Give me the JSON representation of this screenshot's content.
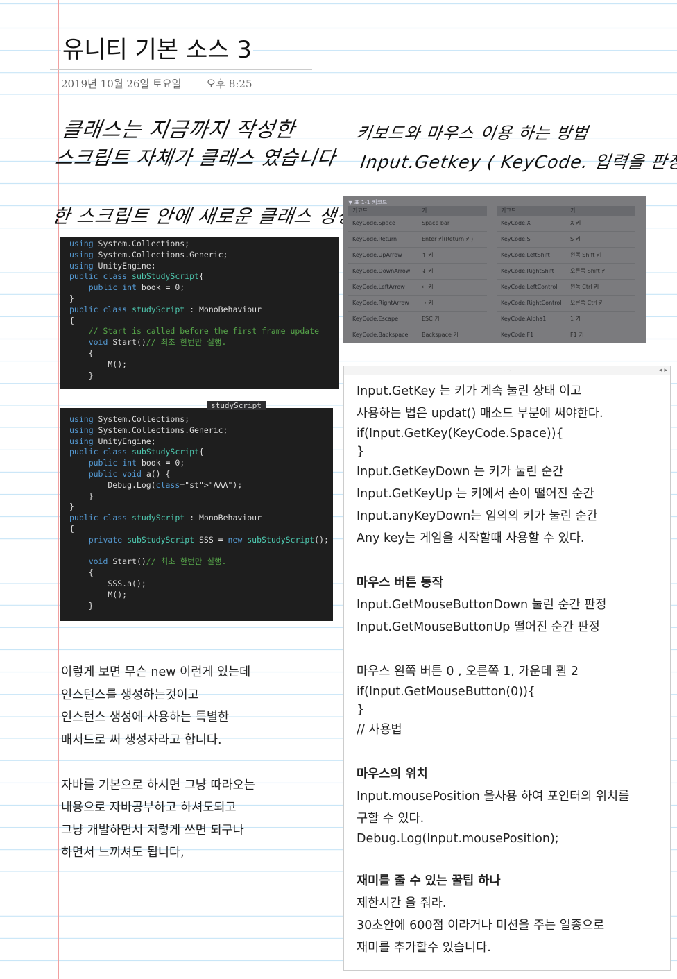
{
  "note": {
    "title": "유니티 기본 소스 3",
    "date": "2019년 10월 26일 토요일",
    "time": "오후 8:25"
  },
  "handwriting": {
    "line1": "클래스는 지금까지 작성한",
    "line2": "스크립트 자체가 클래스 였습니다",
    "line3": "한 스크립트 안에 새로운 클래스 생성 가능",
    "right1": "키보드와 마우스 이용 하는 방법",
    "right2": "Input.Getkey ( KeyCode. 입력을 판정할키)"
  },
  "code1": {
    "lines": [
      "using System.Collections;",
      "using System.Collections.Generic;",
      "using UnityEngine;",
      "public class subStudyScript{",
      "    public int book = 0;",
      "}",
      "public class studyScript : MonoBehaviour",
      "{",
      "    // Start is called before the first frame update",
      "    void Start()// 최초 한번만 실행.",
      "    {",
      "        M();",
      "    }"
    ]
  },
  "code2": {
    "tab": "studyScript",
    "lines": [
      "using System.Collections;",
      "using System.Collections.Generic;",
      "using UnityEngine;",
      "public class subStudyScript{",
      "    public int book = 0;",
      "    public void a() {",
      "        Debug.Log(\"AAA\");",
      "    }",
      "}",
      "public class studyScript : MonoBehaviour",
      "{",
      "    private subStudyScript SSS = new subStudyScript();",
      "",
      "    void Start()// 최초 한번만 실행.",
      "    {",
      "        SSS.a();",
      "        M();",
      "    }"
    ]
  },
  "keytable": {
    "caption": "▼ 표 1-1 키코드",
    "head_key": "키코드",
    "head_val": "키",
    "left": [
      [
        "KeyCode.Space",
        "Space bar"
      ],
      [
        "KeyCode.Return",
        "Enter 키(Return 키)"
      ],
      [
        "KeyCode.UpArrow",
        "↑ 키"
      ],
      [
        "KeyCode.DownArrow",
        "↓ 키"
      ],
      [
        "KeyCode.LeftArrow",
        "← 키"
      ],
      [
        "KeyCode.RightArrow",
        "→ 키"
      ],
      [
        "KeyCode.Escape",
        "ESC 키"
      ],
      [
        "KeyCode.Backspace",
        "Backspace 키"
      ]
    ],
    "right": [
      [
        "KeyCode.X",
        "X 키"
      ],
      [
        "KeyCode.S",
        "S 키"
      ],
      [
        "KeyCode.LeftShift",
        "왼쪽 Shift 키"
      ],
      [
        "KeyCode.RightShift",
        "오른쪽 Shift 키"
      ],
      [
        "KeyCode.LeftControl",
        "왼쪽 Ctrl 키"
      ],
      [
        "KeyCode.RightControl",
        "오른쪽 Ctrl 키"
      ],
      [
        "KeyCode.Alpha1",
        "1 키"
      ],
      [
        "KeyCode.F1",
        "F1 키"
      ]
    ]
  },
  "panel": {
    "handle": "....",
    "arrows": "◂ ▸",
    "lines": [
      "Input.GetKey 는 키가 계속 눌린 상태 이고",
      "사용하는 법은 updat()  매소드 부분에 써야한다.",
      "if(Input.GetKey(KeyCode.Space)){",
      "}",
      "Input.GetKeyDown 는 키가 눌린 순간",
      "Input.GetKeyUp 는 키에서 손이 떨어진 순간",
      "Input.anyKeyDown는 임의의 키가 눌린 순간",
      "Any key는 게임을 시작할때 사용할 수 있다.",
      "",
      "마우스 버튼 동작",
      "Input.GetMouseButtonDown 눌린 순간 판정",
      "Input.GetMouseButtonUp 떨어진 순간 판정",
      "",
      "마우스 왼쪽 버튼 0 , 오른쪽 1, 가운데 휠 2",
      "if(Input.GetMouseButton(0)){",
      "}",
      "// 사용법",
      "",
      "마우스의 위치",
      "Input.mousePosition 을사용 하여 포인터의 위치를",
      "구할 수 있다.",
      "Debug.Log(Input.mousePosition);",
      "",
      "재미를 줄 수 있는 꿀팁 하나",
      " 제한시간 을 줘라.",
      "30초안에 600점 이라거나 미션을 주는 일종으로",
      "재미를 추가할수 있습니다."
    ]
  },
  "left_text": {
    "lines": [
      "이렇게 보면 무슨 new 이런게 있는데",
      "인스턴스를 생성하는것이고",
      "인스턴스 생성에 사용하는 특별한",
      "매서드로 써 생성자라고 합니다.",
      "",
      "자바를 기본으로 하시면 그냥 따라오는",
      "내용으로 자바공부하고 하셔도되고",
      "그냥 개발하면서 저렇게 쓰면 되구나",
      "하면서 느끼셔도 됩니다,"
    ]
  }
}
